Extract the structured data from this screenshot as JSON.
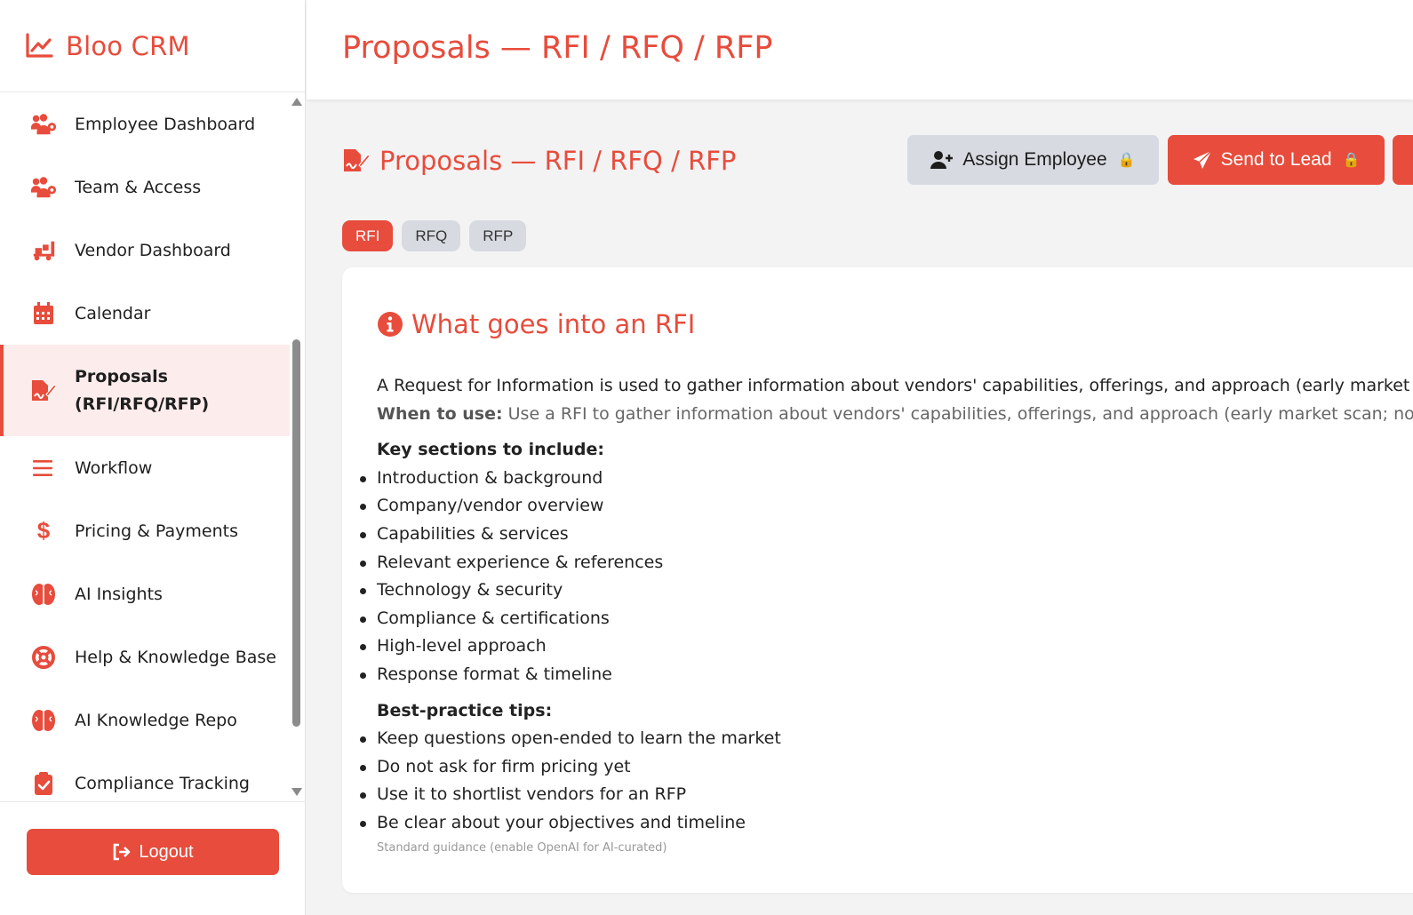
{
  "app": {
    "brand": "Bloo CRM",
    "accent": "#e74c3c"
  },
  "sidebar": {
    "items": [
      {
        "label": "Employee Dashboard",
        "icon": "users-gear-icon"
      },
      {
        "label": "Team & Access",
        "icon": "users-gear-icon"
      },
      {
        "label": "Vendor Dashboard",
        "icon": "truck-ramp-icon"
      },
      {
        "label": "Calendar",
        "icon": "calendar-icon"
      },
      {
        "label_line1": "Proposals",
        "label_line2": "(RFI/RFQ/RFP)",
        "icon": "file-signature-icon",
        "active": true
      },
      {
        "label": "Workflow",
        "icon": "bars-icon"
      },
      {
        "label": "Pricing & Payments",
        "icon": "dollar-icon"
      },
      {
        "label": "AI Insights",
        "icon": "brain-icon"
      },
      {
        "label": "Help & Knowledge Base",
        "icon": "life-ring-icon"
      },
      {
        "label": "AI Knowledge Repo",
        "icon": "brain-icon"
      },
      {
        "label": "Compliance Tracking",
        "icon": "clipboard-check-icon"
      }
    ],
    "logout_label": "Logout"
  },
  "header": {
    "title": "Proposals — RFI / RFQ / RFP"
  },
  "main": {
    "section_title": "Proposals — RFI / RFQ / RFP",
    "assign_label": "Assign Employee",
    "send_label": "Send to Lead",
    "lock_glyph": "🔒",
    "tabs": [
      {
        "label": "RFI",
        "active": true
      },
      {
        "label": "RFQ"
      },
      {
        "label": "RFP"
      }
    ],
    "card": {
      "title": "What goes into an RFI",
      "intro": "A Request for Information is used to gather information about vendors' capabilities, offerings, and approach (early market scan; no pricing commitments).",
      "when_label": "When to use:",
      "when_text": " Use a RFI to gather information about vendors' capabilities, offerings, and approach (early market scan; no pricing commitments).",
      "key_sections_heading": "Key sections to include:",
      "key_sections": [
        "Introduction & background",
        "Company/vendor overview",
        "Capabilities & services",
        "Relevant experience & references",
        "Technology & security",
        "Compliance & certifications",
        "High-level approach",
        "Response format & timeline"
      ],
      "tips_heading": "Best-practice tips:",
      "tips": [
        "Keep questions open-ended to learn the market",
        "Do not ask for firm pricing yet",
        "Use it to shortlist vendors for an RFP",
        "Be clear about your objectives and timeline"
      ],
      "note": "Standard guidance (enable OpenAI for AI-curated)"
    }
  }
}
